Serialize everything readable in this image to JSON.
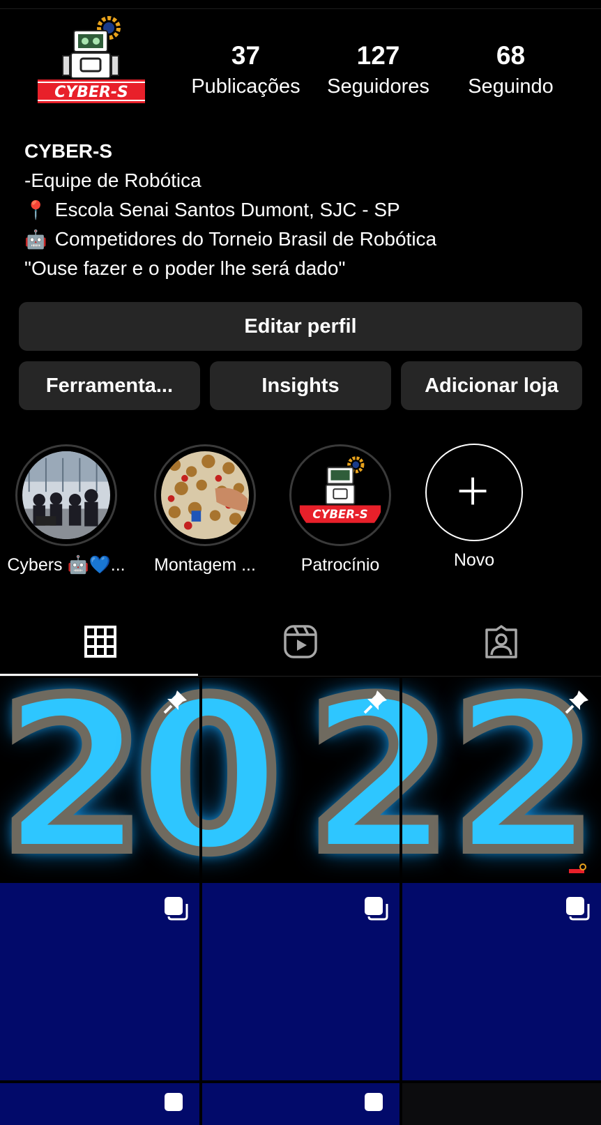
{
  "profile": {
    "stats": [
      {
        "value": "37",
        "label": "Publicações"
      },
      {
        "value": "127",
        "label": "Seguidores"
      },
      {
        "value": "68",
        "label": "Seguindo"
      }
    ],
    "logo_text": "CYBER-S",
    "bio": {
      "name": "CYBER-S",
      "line1": "-Equipe de Robótica",
      "line2_emoji": "📍",
      "line2": "Escola Senai Santos Dumont, SJC - SP",
      "line3_emoji": "🤖",
      "line3": "Competidores do Torneio Brasil de Robótica",
      "line4": "\"Ouse fazer e o poder lhe será dado\""
    }
  },
  "buttons": {
    "edit": "Editar perfil",
    "tools": "Ferramenta...",
    "insights": "Insights",
    "shop": "Adicionar loja"
  },
  "highlights": [
    {
      "label": "Cybers 🤖💙..."
    },
    {
      "label": "Montagem ..."
    },
    {
      "label": "Patrocínio"
    },
    {
      "label": "Novo"
    }
  ],
  "tabs": {
    "active": "grid",
    "icons": [
      "grid-icon",
      "reels-icon",
      "tagged-icon"
    ]
  },
  "grid": {
    "pinned_digits": [
      "2",
      "0",
      "2",
      "2"
    ],
    "colors": {
      "neon": "#2ec6ff",
      "post_blue": "#020a6a",
      "button_bg": "#262626"
    }
  }
}
